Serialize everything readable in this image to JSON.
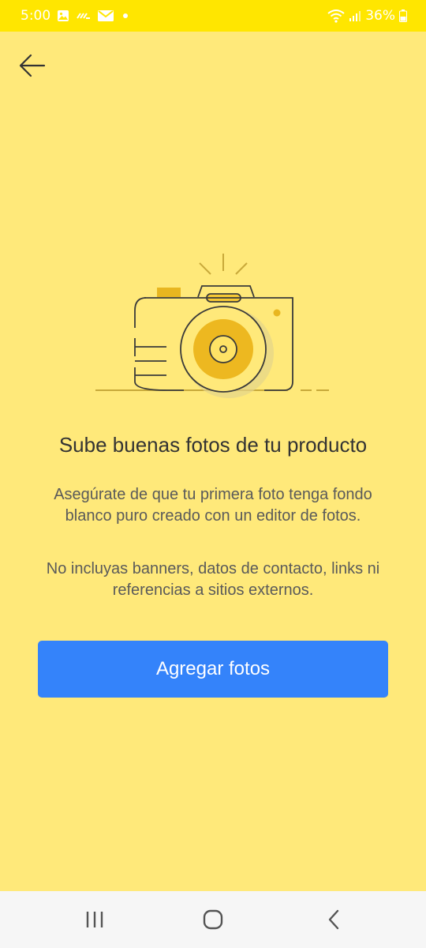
{
  "status_bar": {
    "time": "5:00",
    "battery": "36%",
    "icons": [
      "gallery-icon",
      "missed-call-icon",
      "mail-icon",
      "dot-icon",
      "wifi-icon",
      "signal-icon",
      "battery-icon"
    ]
  },
  "header": {
    "back_icon": "arrow-left-icon"
  },
  "content": {
    "illustration": "camera-illustration",
    "title": "Sube buenas fotos de tu producto",
    "description_1": "Asegúrate de que tu primera foto tenga fondo blanco puro creado con un editor de fotos.",
    "description_2": "No incluyas banners, datos de contacto, links ni referencias a sitios externos."
  },
  "actions": {
    "add_photos_label": "Agregar fotos"
  },
  "nav_bar": {
    "icons": [
      "recents-icon",
      "home-icon",
      "back-icon"
    ]
  },
  "colors": {
    "status_bar": "#FFE600",
    "background": "#FFE97A",
    "accent": "#3483FA",
    "nav_bar": "#F6F6F6"
  }
}
